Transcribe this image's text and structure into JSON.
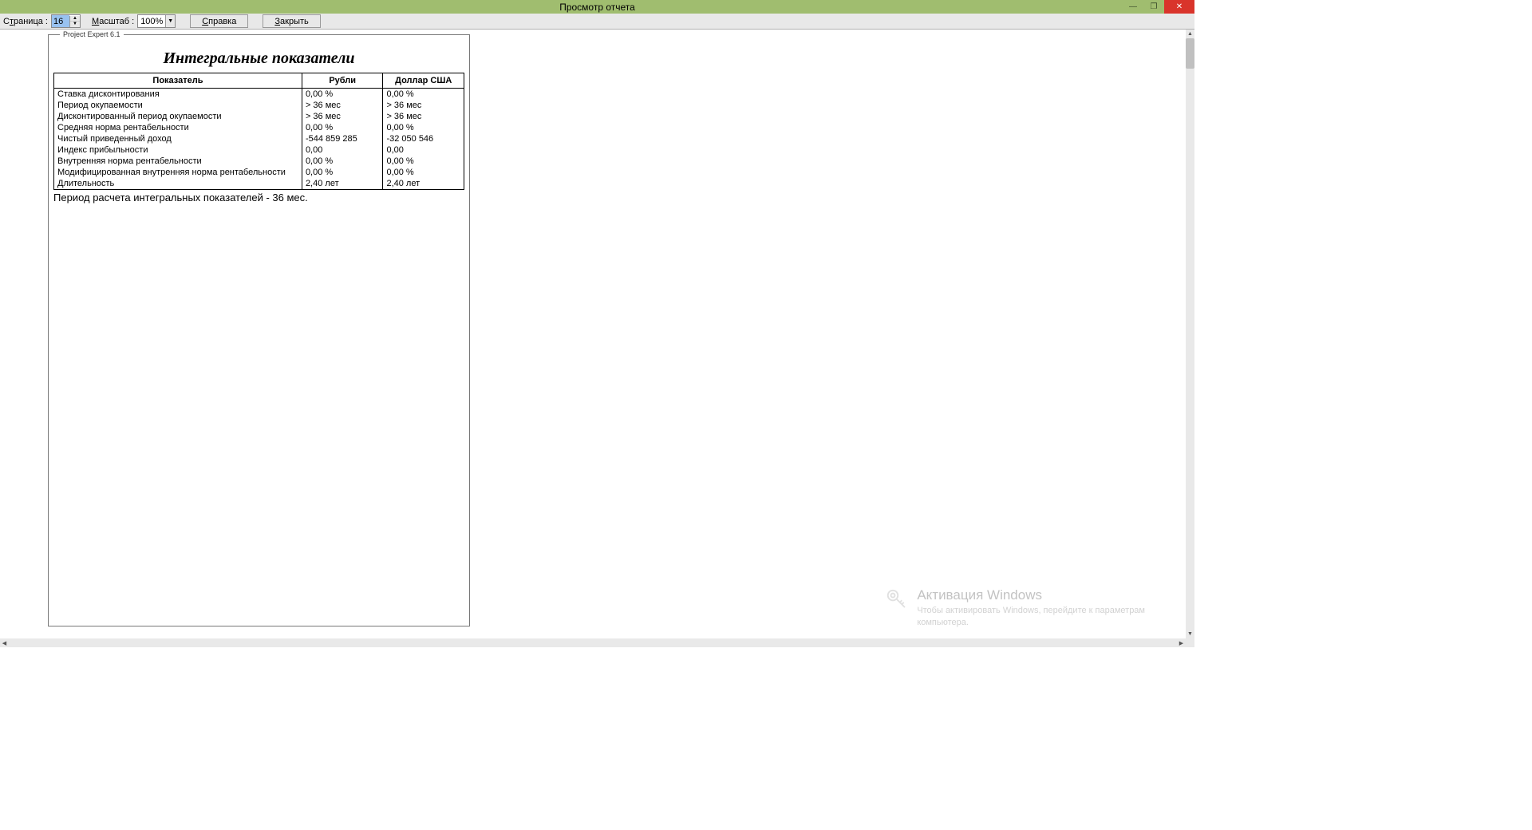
{
  "window": {
    "title": "Просмотр отчета"
  },
  "toolbar": {
    "page_label_prefix": "С",
    "page_label_u": "т",
    "page_label_suffix": "раница :",
    "page_value": "16",
    "zoom_label_prefix": "",
    "zoom_label_u": "М",
    "zoom_label_suffix": "асштаб :",
    "zoom_value": "100%",
    "help_prefix": "",
    "help_u": "С",
    "help_suffix": "правка",
    "close_prefix": "",
    "close_u": "З",
    "close_suffix": "акрыть"
  },
  "report": {
    "legend": "Project Expert 6.1",
    "title": "Интегральные показатели",
    "headers": {
      "indicator": "Показатель",
      "rub": "Рубли",
      "usd": "Доллар США"
    },
    "rows": [
      {
        "ind": "Ставка дисконтирования",
        "rub": "0,00 %",
        "usd": "0,00 %"
      },
      {
        "ind": "Период окупаемости",
        "rub": "> 36 мес",
        "usd": "> 36 мес"
      },
      {
        "ind": "Дисконтированный период окупаемости",
        "rub": "> 36 мес",
        "usd": "> 36 мес"
      },
      {
        "ind": "Средняя норма рентабельности",
        "rub": "0,00 %",
        "usd": "0,00 %"
      },
      {
        "ind": "Чистый приведенный доход",
        "rub": "-544 859 285",
        "usd": "-32 050 546"
      },
      {
        "ind": "Индекс прибыльности",
        "rub": "0,00",
        "usd": "0,00"
      },
      {
        "ind": "Внутренняя норма рентабельности",
        "rub": "0,00 %",
        "usd": "0,00 %"
      },
      {
        "ind": "Модифицированная внутренняя норма рентабельности",
        "rub": "0,00 %",
        "usd": "0,00 %"
      },
      {
        "ind": "Длительность",
        "rub": "2,40 лет",
        "usd": "2,40 лет"
      }
    ],
    "note": "Период расчета интегральных показателей - 36 мес."
  },
  "watermark": {
    "title": "Активация Windows",
    "text1": "Чтобы активировать Windows, перейдите к параметрам",
    "text2": "компьютера."
  }
}
